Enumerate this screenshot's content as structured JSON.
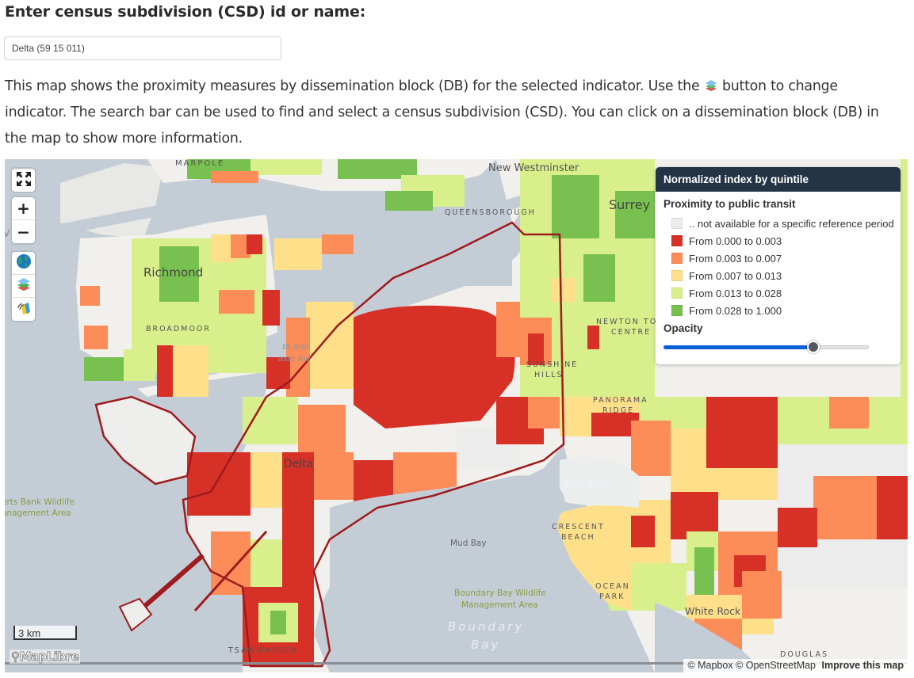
{
  "heading": "Enter census subdivision (CSD) id or name:",
  "search": {
    "value": "Delta (59 15 011)",
    "placeholder": ""
  },
  "intro": {
    "part1": "This map shows the proximity measures by dissemination block (DB) for the selected indicator. Use the ",
    "part2": " button to change indicator. The search bar can be used to find and select a census subdivision (CSD). You can click on a dissemination block (DB) in the map to show more information.",
    "inline_icon": "layers-icon"
  },
  "map": {
    "controls": {
      "fullscreen": {
        "icon": "fullscreen-icon"
      },
      "zoom_in": {
        "label": "+",
        "icon": "plus-icon"
      },
      "zoom_out": {
        "label": "−",
        "icon": "minus-icon"
      },
      "basemap": {
        "icon": "globe-icon"
      },
      "indicator": {
        "icon": "layers-icon"
      },
      "paint": {
        "icon": "paint-tube-icon"
      }
    },
    "labels": {
      "marpole": "MARPOLE",
      "new_westminster": "New Westminster",
      "queensborough": "QUEENSBOROUGH",
      "surrey": "Surrey",
      "richmond": "Richmond",
      "broadmoor": "BROADMOOR",
      "newton1": "NEWTON TOWN",
      "newton2": "CENTRE",
      "sunshine1": "SUNSHINE",
      "sunshine2": "HILLS",
      "panorama1": "PANORAMA",
      "panorama2": "RIDGE",
      "north_arm1": "th Arm",
      "north_arm2": "aser Riv",
      "delta": "Delta",
      "roberts1": "erts Bank Wildlife",
      "roberts2": "anagement Area",
      "mud_bay_italic": "Mud Bay",
      "mud_bay": "Mud Bay",
      "crescent1": "CRESCENT",
      "crescent2": "BEACH",
      "boundary_wma1": "Boundary Bay Wildlife",
      "boundary_wma2": "Management Area",
      "boundary_bay1": "Boundary",
      "boundary_bay2": "Bay",
      "ocean1": "OCEAN",
      "ocean2": "PARK",
      "white_rock": "White Rock",
      "tsawwassen": "TSAWWASSEN",
      "douglas": "DOUGLAS",
      "ve": "V"
    },
    "scale_label": "3 km",
    "logo": "MapLibre",
    "attribution": {
      "mapbox": "© Mapbox",
      "osm": "© OpenStreetMap",
      "improve": "Improve this map"
    }
  },
  "legend": {
    "title": "Normalized index by quintile",
    "indicator": "Proximity to public transit",
    "items": [
      {
        "label": ".. not available for a specific reference period",
        "color": "#ececec"
      },
      {
        "label": "From 0.000 to 0.003",
        "color": "#d73027"
      },
      {
        "label": "From 0.003 to 0.007",
        "color": "#fc8d59"
      },
      {
        "label": "From 0.007 to 0.013",
        "color": "#fee08b"
      },
      {
        "label": "From 0.013 to 0.028",
        "color": "#d9ef8b"
      },
      {
        "label": "From 0.028 to 1.000",
        "color": "#78c050"
      }
    ],
    "opacity_label": "Opacity",
    "opacity_value": 0.73
  },
  "colors": {
    "water": "#c4cdd6",
    "land": "#f2f1ee",
    "boundary": "#9e1b1e",
    "legend_header": "#243447",
    "slider_fill": "#0a5fd6"
  }
}
